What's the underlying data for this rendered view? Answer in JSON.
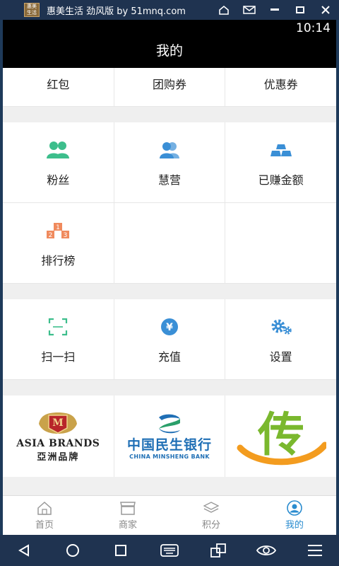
{
  "window": {
    "title": "惠美生活 劲风版 by 51mnq.com",
    "logo_text": "惠美生活"
  },
  "status": {
    "time": "10:14"
  },
  "appbar": {
    "title": "我的"
  },
  "top_row": [
    {
      "label": "红包"
    },
    {
      "label": "团购券"
    },
    {
      "label": "优惠券"
    }
  ],
  "row1": [
    {
      "label": "粉丝",
      "icon": "fans-icon",
      "color": "#3dbe8c"
    },
    {
      "label": "慧营",
      "icon": "users-icon",
      "color": "#3a8fd6"
    },
    {
      "label": "已赚金额",
      "icon": "gold-bars-icon",
      "color": "#3a8fd6"
    }
  ],
  "row2": [
    {
      "label": "排行榜",
      "icon": "ranking-podium-icon",
      "color": "#f08a5d",
      "badges": [
        "1",
        "2",
        "3"
      ]
    }
  ],
  "row3": [
    {
      "label": "扫一扫",
      "icon": "scan-icon",
      "color": "#3dbe8c"
    },
    {
      "label": "充值",
      "icon": "yen-icon",
      "color": "#3a8fd6",
      "symbol": "¥"
    },
    {
      "label": "设置",
      "icon": "gears-icon",
      "color": "#3a8fd6"
    }
  ],
  "brands": {
    "asia": {
      "name": "ASIA BRANDS",
      "cn": "亞洲品牌",
      "emblem_letter": "M"
    },
    "bank": {
      "cn": "中国民生银行",
      "en": "CHINA MINSHENG BANK"
    },
    "chuan": {
      "text": "传"
    }
  },
  "tabs": [
    {
      "label": "首页",
      "icon": "home-icon",
      "active": false
    },
    {
      "label": "商家",
      "icon": "store-icon",
      "active": false
    },
    {
      "label": "积分",
      "icon": "layers-icon",
      "active": false
    },
    {
      "label": "我的",
      "icon": "profile-icon",
      "active": true
    }
  ],
  "colors": {
    "accent": "#2a8ccf",
    "green": "#3dbe8c",
    "blue": "#3a8fd6",
    "orange": "#f08a5d"
  }
}
